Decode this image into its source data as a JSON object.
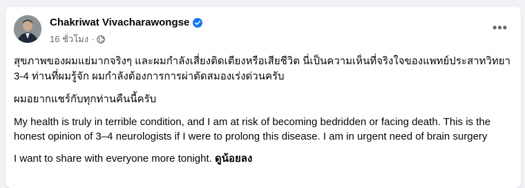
{
  "post": {
    "author_name": "Chakriwat Vivacharawongse",
    "timestamp": "16 ชั่วโมง",
    "separator": "·",
    "paragraphs": [
      "สุขภาพของผมแย่มากจริงๆ และผมกำลังเสี่ยงติดเตียงหรือเสียชีวิต นี่เป็นความเห็นที่จริงใจของแพทย์ประสาทวิทยา 3-4 ท่านที่ผมรู้จัก ผมกำลังต้องการการผ่าตัดสมองเร่งด่วนครับ",
      "ผมอยากแชร์กับทุกท่านคืนนี้ครับ",
      "My health is truly in terrible condition, and I am at risk of becoming bedridden or facing death. This is the honest opinion of 3–4 neurologists if I were to prolong this disease. I am in urgent need of brain surgery"
    ],
    "last_line_text": "I want to share with everyone more tonight.",
    "last_line_bold": "ดูน้อยลง",
    "more_label": "•••",
    "icons": {
      "verified": "verified-badge-icon",
      "audience": "globe-icon",
      "more": "more-options-icon"
    },
    "colors": {
      "verified": "#1877f2",
      "meta_text": "#65676b"
    }
  }
}
